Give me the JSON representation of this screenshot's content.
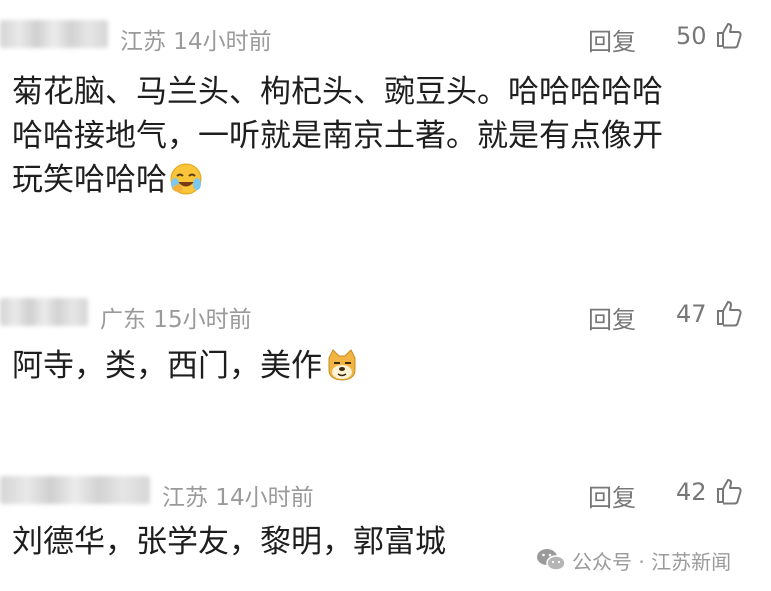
{
  "comments": [
    {
      "region_time": "江苏 14小时前",
      "reply_label": "回复",
      "likes": "50",
      "lines": [
        "菊花脑、马兰头、枸杞头、豌豆头。哈哈哈哈哈",
        "哈哈接地气，一听就是南京土著。就是有点像开",
        "玩笑哈哈哈"
      ],
      "emoji": "laughing-crying-face"
    },
    {
      "region_time": "广东 15小时前",
      "reply_label": "回复",
      "likes": "47",
      "lines": [
        "阿寺，类，西门，美作"
      ],
      "emoji": "doge-face"
    },
    {
      "region_time": "江苏 14小时前",
      "reply_label": "回复",
      "likes": "42",
      "lines": [
        "刘德华，张学友，黎明，郭富城"
      ],
      "emoji": ""
    }
  ],
  "watermark": {
    "icon": "wechat-icon",
    "text": "公众号 · 江苏新闻"
  },
  "colors": {
    "text": "#1e1e1e",
    "meta": "#9a9a9a",
    "action": "#777777"
  }
}
